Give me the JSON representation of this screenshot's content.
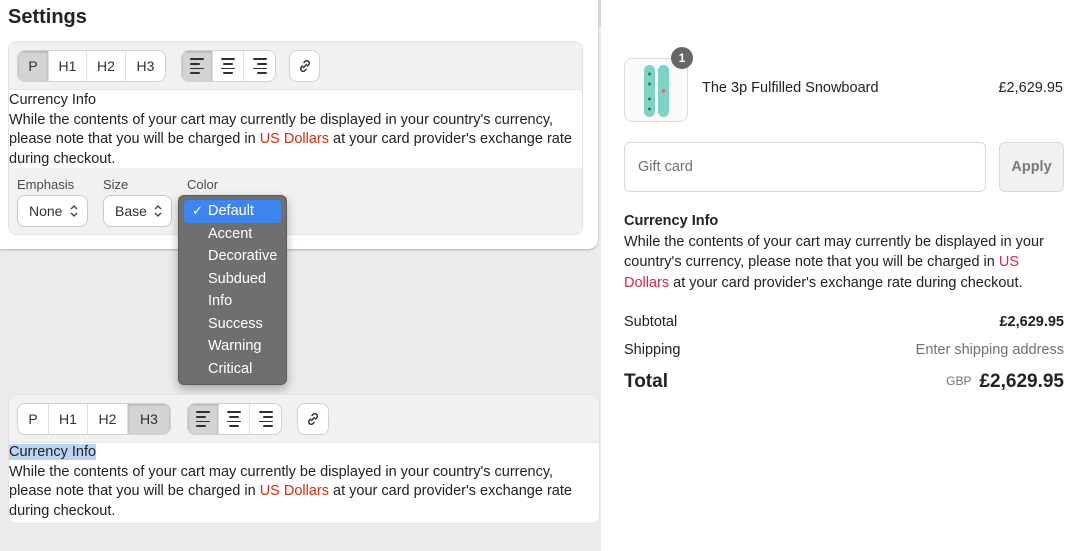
{
  "settings": {
    "title": "Settings"
  },
  "editor_top": {
    "format_buttons": [
      "P",
      "H1",
      "H2",
      "H3"
    ],
    "selected_format": "P",
    "heading": "Currency Info",
    "body_before": "While the contents of your cart may currently be displayed in your country's currency, please note that you will be charged in ",
    "body_highlight": "US Dollars",
    "body_after": " at your card provider's exchange rate during checkout.",
    "props": {
      "emphasis_label": "Emphasis",
      "emphasis_value": "None",
      "size_label": "Size",
      "size_value": "Base",
      "color_label": "Color"
    }
  },
  "color_dropdown": {
    "selected": "Default",
    "options": [
      "Default",
      "Accent",
      "Decorative",
      "Subdued",
      "Info",
      "Success",
      "Warning",
      "Critical"
    ]
  },
  "editor_bottom": {
    "format_buttons": [
      "P",
      "H1",
      "H2",
      "H3"
    ],
    "selected_format": "H3",
    "heading": "Currency Info",
    "body_before": "While the contents of your cart may currently be displayed in your country's currency, please note that you will be charged in ",
    "body_highlight": "US Dollars",
    "body_after": " at your card provider's exchange rate during checkout."
  },
  "cart": {
    "quantity_badge": "1",
    "product_name": "The 3p Fulfilled Snowboard",
    "product_price": "£2,629.95",
    "gift_card_placeholder": "Gift card",
    "apply_label": "Apply",
    "info_heading": "Currency Info",
    "info_before": "While the contents of your cart may currently be displayed in your country's currency, please note that you will be charged in ",
    "info_highlight": "US Dollars",
    "info_after": " at your card provider's exchange rate during checkout.",
    "subtotal_label": "Subtotal",
    "subtotal_value": "£2,629.95",
    "shipping_label": "Shipping",
    "shipping_value": "Enter shipping address",
    "total_label": "Total",
    "total_currency": "GBP",
    "total_value": "£2,629.95"
  },
  "colors": {
    "highlight_red": "#d72c0d",
    "dropdown_highlight": "#3d86f0",
    "focus_blue": "#2c6ecb"
  },
  "icons": [
    "align-left-icon",
    "align-center-icon",
    "align-right-icon",
    "link-icon",
    "chevron-updown-icon",
    "checkmark-icon",
    "snowboard-image"
  ]
}
